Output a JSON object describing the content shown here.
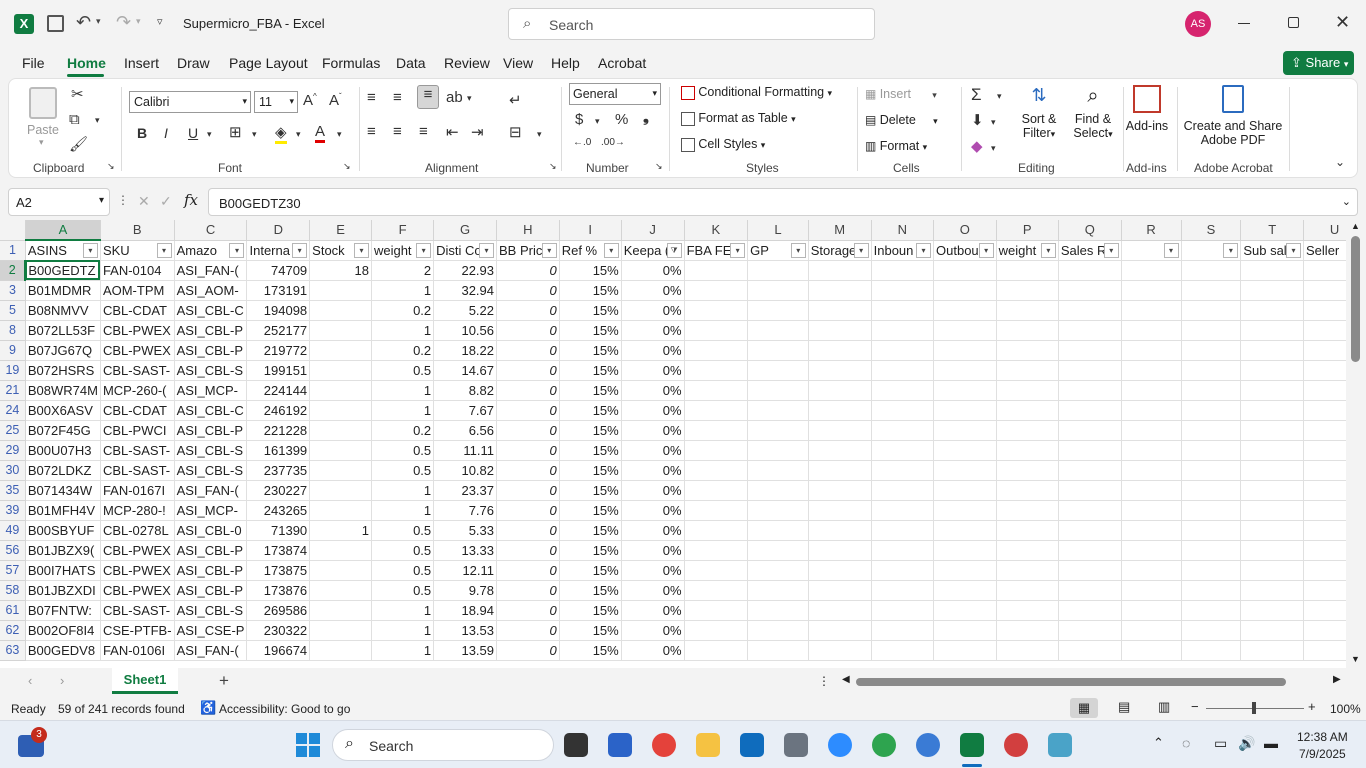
{
  "titlebar": {
    "filename": "Supermicro_FBA",
    "separator": "-",
    "app": "Excel",
    "search_placeholder": "Search",
    "avatar_initials": "AS"
  },
  "menu": {
    "tabs": [
      "File",
      "Home",
      "Insert",
      "Draw",
      "Page Layout",
      "Formulas",
      "Data",
      "Review",
      "View",
      "Help",
      "Acrobat"
    ],
    "active": "Home",
    "share": "Share"
  },
  "ribbon": {
    "clipboard": {
      "paste": "Paste",
      "label": "Clipboard"
    },
    "font": {
      "name": "Calibri",
      "size": "11",
      "label": "Font",
      "bold": "B",
      "italic": "I",
      "underline": "U"
    },
    "alignment": {
      "label": "Alignment"
    },
    "number": {
      "format": "General",
      "label": "Number"
    },
    "styles": {
      "conditional": "Conditional Formatting",
      "format_table": "Format as Table",
      "cell_styles": "Cell Styles",
      "label": "Styles"
    },
    "cells": {
      "insert": "Insert",
      "delete": "Delete",
      "format": "Format",
      "label": "Cells"
    },
    "editing": {
      "sort": "Sort &",
      "filter": "Filter",
      "find": "Find &",
      "select": "Select",
      "label": "Editing"
    },
    "addins": {
      "button": "Add-ins",
      "label": "Add-ins"
    },
    "acrobat": {
      "line1": "Create and Share",
      "line2": "Adobe PDF",
      "label": "Adobe Acrobat"
    }
  },
  "formula_bar": {
    "name_box": "A2",
    "fx": "fx",
    "value": "B00GEDTZ30"
  },
  "sheet": {
    "columns": [
      "A",
      "B",
      "C",
      "D",
      "E",
      "F",
      "G",
      "H",
      "I",
      "J",
      "K",
      "L",
      "M",
      "N",
      "O",
      "P",
      "Q",
      "R",
      "S",
      "T",
      "U"
    ],
    "headers": [
      "ASINS",
      "SKU",
      "Amazo",
      "Interna",
      "Stock",
      "weight",
      "Disti Co",
      "BB Pric",
      "Ref %",
      "Keepa (",
      "FBA FEE",
      "GP",
      "Storage",
      "Inboun",
      "Outbou",
      "weight",
      "Sales R",
      "",
      "",
      "Sub sal",
      "Seller"
    ],
    "rows": [
      {
        "r": "2",
        "c": [
          "B00GEDTZ",
          "FAN-0104",
          "ASI_FAN-(",
          "74709",
          "18",
          "2",
          "22.93",
          "0",
          "15%",
          "0%"
        ]
      },
      {
        "r": "3",
        "c": [
          "B01MDMR",
          "AOM-TPM",
          "ASI_AOM-",
          "173191",
          "",
          "1",
          "32.94",
          "0",
          "15%",
          "0%"
        ]
      },
      {
        "r": "5",
        "c": [
          "B08NMVV",
          "CBL-CDAT",
          "ASI_CBL-C",
          "194098",
          "",
          "0.2",
          "5.22",
          "0",
          "15%",
          "0%"
        ]
      },
      {
        "r": "8",
        "c": [
          "B072LL53F",
          "CBL-PWEX",
          "ASI_CBL-P",
          "252177",
          "",
          "1",
          "10.56",
          "0",
          "15%",
          "0%"
        ]
      },
      {
        "r": "9",
        "c": [
          "B07JG67Q",
          "CBL-PWEX",
          "ASI_CBL-P",
          "219772",
          "",
          "0.2",
          "18.22",
          "0",
          "15%",
          "0%"
        ]
      },
      {
        "r": "19",
        "c": [
          "B072HSRS",
          "CBL-SAST-",
          "ASI_CBL-S",
          "199151",
          "",
          "0.5",
          "14.67",
          "0",
          "15%",
          "0%"
        ]
      },
      {
        "r": "21",
        "c": [
          "B08WR74M",
          "MCP-260-(",
          "ASI_MCP-",
          "224144",
          "",
          "1",
          "8.82",
          "0",
          "15%",
          "0%"
        ]
      },
      {
        "r": "24",
        "c": [
          "B00X6ASV",
          "CBL-CDAT",
          "ASI_CBL-C",
          "246192",
          "",
          "1",
          "7.67",
          "0",
          "15%",
          "0%"
        ]
      },
      {
        "r": "25",
        "c": [
          "B072F45G",
          "CBL-PWCI",
          "ASI_CBL-P",
          "221228",
          "",
          "0.2",
          "6.56",
          "0",
          "15%",
          "0%"
        ]
      },
      {
        "r": "29",
        "c": [
          "B00U07H3",
          "CBL-SAST-",
          "ASI_CBL-S",
          "161399",
          "",
          "0.5",
          "11.11",
          "0",
          "15%",
          "0%"
        ]
      },
      {
        "r": "30",
        "c": [
          "B072LDKZ",
          "CBL-SAST-",
          "ASI_CBL-S",
          "237735",
          "",
          "0.5",
          "10.82",
          "0",
          "15%",
          "0%"
        ]
      },
      {
        "r": "35",
        "c": [
          "B071434W",
          "FAN-0167I",
          "ASI_FAN-(",
          "230227",
          "",
          "1",
          "23.37",
          "0",
          "15%",
          "0%"
        ]
      },
      {
        "r": "39",
        "c": [
          "B01MFH4V",
          "MCP-280-!",
          "ASI_MCP-",
          "243265",
          "",
          "1",
          "7.76",
          "0",
          "15%",
          "0%"
        ]
      },
      {
        "r": "49",
        "c": [
          "B00SBYUF",
          "CBL-0278L",
          "ASI_CBL-0",
          "71390",
          "1",
          "0.5",
          "5.33",
          "0",
          "15%",
          "0%"
        ]
      },
      {
        "r": "56",
        "c": [
          "B01JBZX9(",
          "CBL-PWEX",
          "ASI_CBL-P",
          "173874",
          "",
          "0.5",
          "13.33",
          "0",
          "15%",
          "0%"
        ]
      },
      {
        "r": "57",
        "c": [
          "B00I7HATS",
          "CBL-PWEX",
          "ASI_CBL-P",
          "173875",
          "",
          "0.5",
          "12.11",
          "0",
          "15%",
          "0%"
        ]
      },
      {
        "r": "58",
        "c": [
          "B01JBZXDI",
          "CBL-PWEX",
          "ASI_CBL-P",
          "173876",
          "",
          "0.5",
          "9.78",
          "0",
          "15%",
          "0%"
        ]
      },
      {
        "r": "61",
        "c": [
          "B07FNTW:",
          "CBL-SAST-",
          "ASI_CBL-S",
          "269586",
          "",
          "1",
          "18.94",
          "0",
          "15%",
          "0%"
        ]
      },
      {
        "r": "62",
        "c": [
          "B002OF8I4",
          "CSE-PTFB-",
          "ASI_CSE-P",
          "230322",
          "",
          "1",
          "13.53",
          "0",
          "15%",
          "0%"
        ]
      },
      {
        "r": "63",
        "c": [
          "B00GEDV8",
          "FAN-0106I",
          "ASI_FAN-(",
          "196674",
          "",
          "1",
          "13.59",
          "0",
          "15%",
          "0%"
        ]
      }
    ]
  },
  "sheetbar": {
    "tab": "Sheet1",
    "add": "+"
  },
  "status": {
    "ready": "Ready",
    "records": "59 of 241 records found",
    "accessibility": "Accessibility: Good to go",
    "zoom": "100%"
  },
  "taskbar": {
    "search": "Search",
    "badge": "3",
    "time": "12:38 AM",
    "date": "7/9/2025"
  }
}
